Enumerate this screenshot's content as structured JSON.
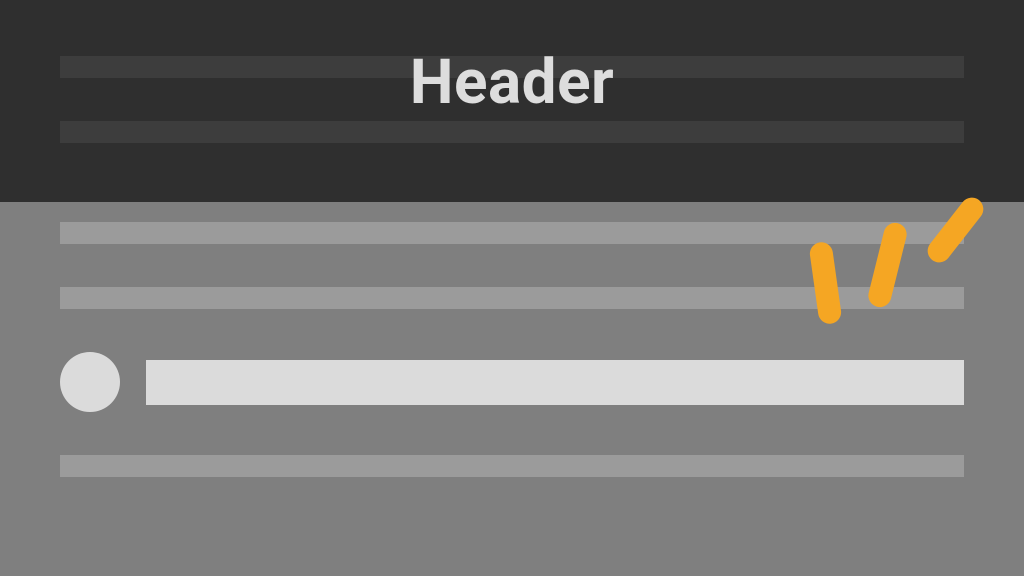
{
  "header": {
    "title": "Header"
  },
  "colors": {
    "header_bg": "#2f2f2f",
    "header_placeholder": "#3d3d3d",
    "content_bg": "#7f7f7f",
    "content_placeholder": "#9b9b9b",
    "item_highlight": "#dbdbdb",
    "header_text": "#dddddd",
    "accent": "#f5a623"
  },
  "diagram": {
    "type": "layout-wireframe",
    "description": "Illustration of a page layout with a dark header area carrying a centered title over two placeholder lines, and a lighter content area with placeholder text lines and a highlighted list item (circular avatar plus text row). Orange hand-drawn strokes emphasize the transition at the header/content boundary.",
    "regions": [
      {
        "name": "header",
        "placeholders": 2,
        "title_present": true
      },
      {
        "name": "content",
        "placeholders": 3,
        "highlighted_item": {
          "has_avatar": true
        }
      }
    ]
  }
}
